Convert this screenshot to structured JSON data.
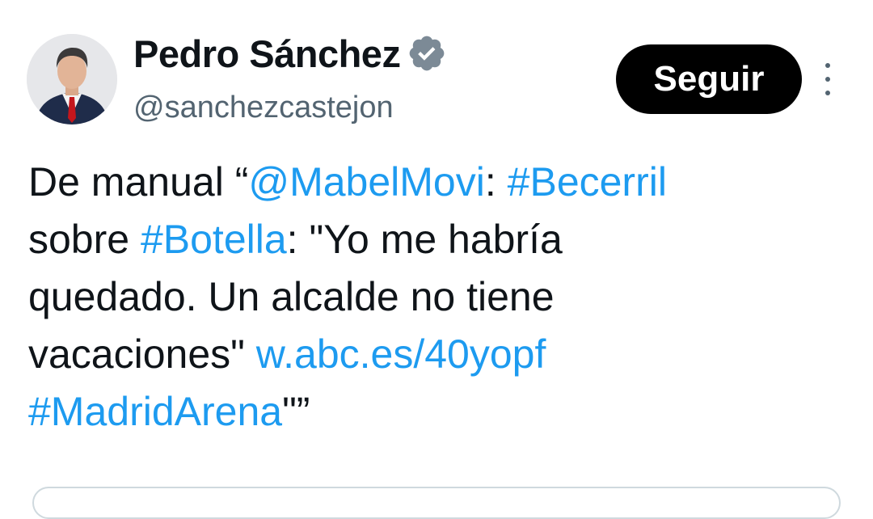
{
  "author": {
    "display_name": "Pedro Sánchez",
    "handle": "@sanchezcastejon",
    "verified_icon": "verified-badge-icon",
    "verified_color": "#7c8a96"
  },
  "follow_button": {
    "label": "Seguir",
    "background": "#000000",
    "text_color": "#ffffff"
  },
  "more_icon": "vertical-ellipsis-icon",
  "tweet": {
    "link_color": "#1d9bf0",
    "lines": [
      [
        {
          "text": "De manual “",
          "link": false
        },
        {
          "text": "@MabelMovi",
          "link": true
        },
        {
          "text": ": ",
          "link": false
        },
        {
          "text": "#Becerril",
          "link": true
        }
      ],
      [
        {
          "text": "sobre ",
          "link": false
        },
        {
          "text": "#Botella",
          "link": true
        },
        {
          "text": ": \"Yo me habría",
          "link": false
        }
      ],
      [
        {
          "text": "quedado. Un alcalde no tiene",
          "link": false
        }
      ],
      [
        {
          "text": "vacaciones\" ",
          "link": false
        },
        {
          "text": "w.abc.es/40yopf",
          "link": true
        }
      ],
      [
        {
          "text": "#MadridArena",
          "link": true
        },
        {
          "text": "\"”",
          "link": false
        }
      ]
    ]
  }
}
